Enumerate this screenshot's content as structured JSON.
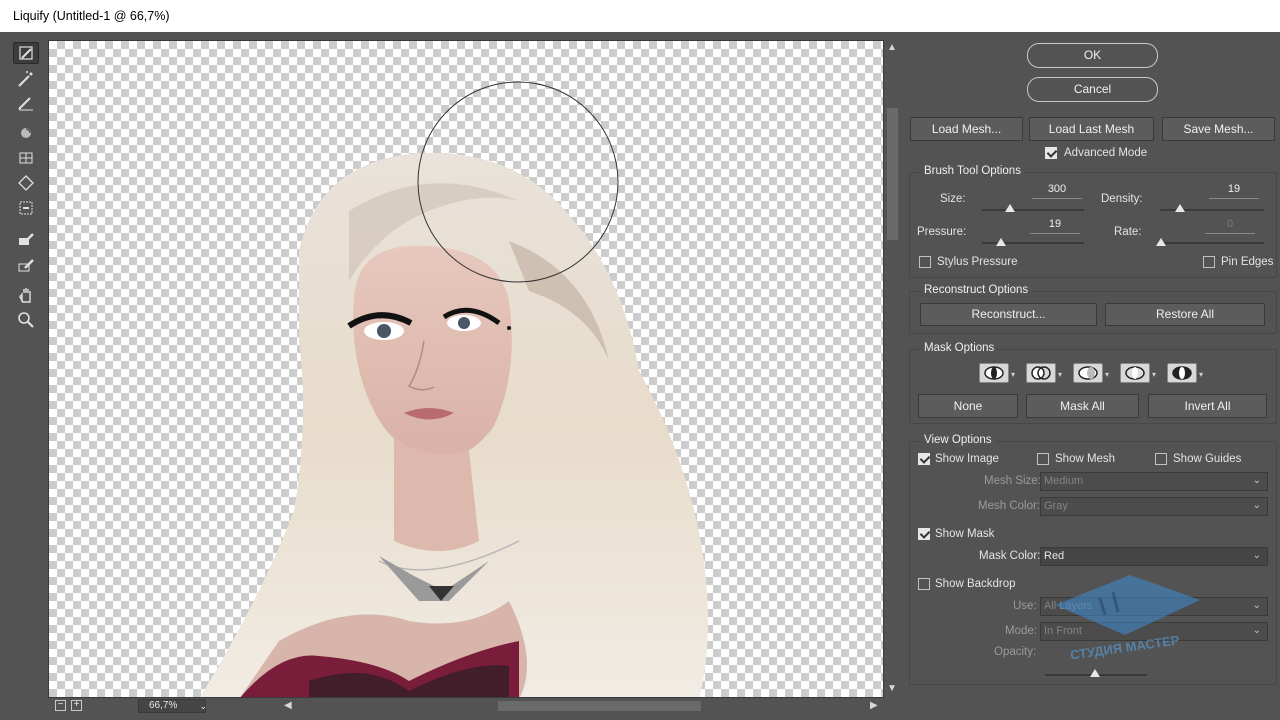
{
  "window": {
    "title": "Liquify (Untitled-1 @ 66,7%)"
  },
  "tools": [
    {
      "name": "forward-warp-tool-icon",
      "active": true
    },
    {
      "name": "reconstruct-tool-icon"
    },
    {
      "name": "smooth-tool-icon"
    },
    {
      "name": "twirl-clockwise-tool-icon"
    },
    {
      "name": "pucker-tool-icon"
    },
    {
      "name": "bloat-tool-icon"
    },
    {
      "name": "push-left-tool-icon"
    },
    {
      "name": "freeze-mask-tool-icon"
    },
    {
      "name": "thaw-mask-tool-icon"
    },
    {
      "name": "hand-tool-icon"
    },
    {
      "name": "zoom-tool-icon"
    }
  ],
  "status": {
    "zoom": "66,7%",
    "zoom_out": "−",
    "zoom_in": "+"
  },
  "buttons": {
    "ok": "OK",
    "cancel": "Cancel"
  },
  "mesh": {
    "load": "Load Mesh...",
    "load_last": "Load Last Mesh",
    "save": "Save Mesh..."
  },
  "advanced_mode": {
    "label": "Advanced Mode",
    "checked": true
  },
  "brush": {
    "title": "Brush Tool Options",
    "size_label": "Size:",
    "size": "300",
    "size_level": 0.08,
    "density_label": "Density:",
    "density": "19",
    "density_level": 0.19,
    "pressure_label": "Pressure:",
    "pressure": "19",
    "pressure_level": 0.19,
    "rate_label": "Rate:",
    "rate": "0",
    "rate_level": 0.0,
    "stylus_label": "Stylus Pressure",
    "pin_label": "Pin Edges"
  },
  "reconstruct": {
    "title": "Reconstruct Options",
    "reconstruct": "Reconstruct...",
    "restore_all": "Restore All"
  },
  "mask": {
    "title": "Mask Options",
    "none": "None",
    "mask_all": "Mask All",
    "invert_all": "Invert All"
  },
  "view": {
    "title": "View Options",
    "show_image": "Show Image",
    "show_mesh": "Show Mesh",
    "show_guides": "Show Guides",
    "mesh_size_label": "Mesh Size:",
    "mesh_size": "Medium",
    "mesh_color_label": "Mesh Color:",
    "mesh_color": "Gray",
    "show_mask": "Show Mask",
    "mask_color_label": "Mask Color:",
    "mask_color": "Red",
    "show_backdrop": "Show Backdrop",
    "use_label": "Use:",
    "use": "All Layers",
    "mode_label": "Mode:",
    "mode": "In Front",
    "opacity_label": "Opacity:",
    "opacity_level": 0.5
  },
  "watermark": {
    "text": "СТУДИЯ МАСТЕР"
  },
  "colors": {
    "panel": "#535353",
    "dark": "#3a3a3a",
    "text": "#e0e0e0"
  }
}
